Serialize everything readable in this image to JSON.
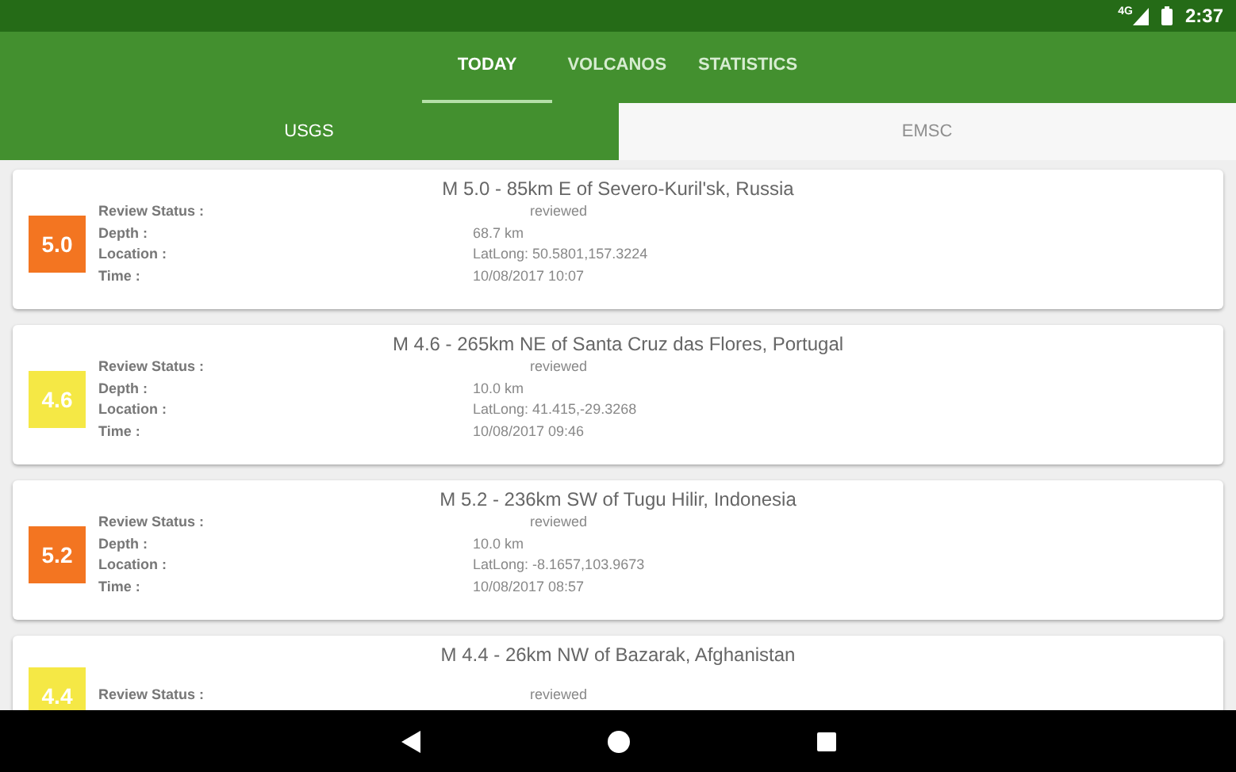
{
  "status_bar": {
    "network": "4G",
    "time": "2:37"
  },
  "tabs": [
    {
      "label": "TODAY",
      "selected": true
    },
    {
      "label": "VOLCANOS",
      "selected": false
    },
    {
      "label": "STATISTICS",
      "selected": false
    }
  ],
  "sources": [
    {
      "label": "USGS",
      "selected": true
    },
    {
      "label": "EMSC",
      "selected": false
    }
  ],
  "quakes": [
    {
      "magnitude": "5.0",
      "color": "#f37521",
      "title": "M 5.0 - 85km E of Severo-Kuril'sk, Russia",
      "fields": [
        {
          "kind": "review",
          "label": "Review Status :",
          "value": "reviewed"
        },
        {
          "kind": "plain",
          "label": "Depth :",
          "value": "68.7 km"
        },
        {
          "kind": "plain",
          "label": "Location :",
          "value": "LatLong: 50.5801,157.3224"
        },
        {
          "kind": "plain",
          "label": "Time :",
          "value": "10/08/2017 10:07"
        }
      ]
    },
    {
      "magnitude": "4.6",
      "color": "#f5e845",
      "title": "M 4.6 - 265km NE of Santa Cruz das Flores, Portugal",
      "fields": [
        {
          "kind": "review",
          "label": "Review Status :",
          "value": "reviewed"
        },
        {
          "kind": "plain",
          "label": "Depth :",
          "value": "10.0 km"
        },
        {
          "kind": "plain",
          "label": "Location :",
          "value": "LatLong: 41.415,-29.3268"
        },
        {
          "kind": "plain",
          "label": "Time :",
          "value": "10/08/2017 09:46"
        }
      ]
    },
    {
      "magnitude": "5.2",
      "color": "#f37521",
      "title": "M 5.2 - 236km SW of Tugu Hilir, Indonesia",
      "fields": [
        {
          "kind": "review",
          "label": "Review Status :",
          "value": "reviewed"
        },
        {
          "kind": "plain",
          "label": "Depth :",
          "value": "10.0 km"
        },
        {
          "kind": "plain",
          "label": "Location :",
          "value": "LatLong: -8.1657,103.9673"
        },
        {
          "kind": "plain",
          "label": "Time :",
          "value": "10/08/2017 08:57"
        }
      ]
    },
    {
      "magnitude": "4.4",
      "color": "#f5e845",
      "title": "M 4.4 - 26km NW of Bazarak, Afghanistan",
      "fields": [
        {
          "kind": "review",
          "label": "Review Status :",
          "value": "reviewed"
        }
      ]
    }
  ]
}
